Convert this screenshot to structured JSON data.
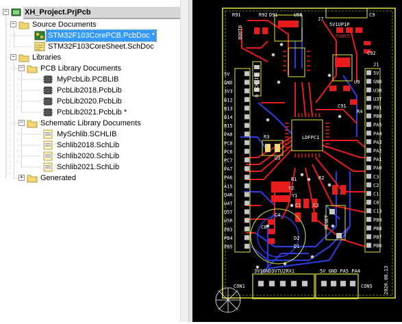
{
  "tree": {
    "root": "XH_Project.PrjPcb",
    "source": {
      "label": "Source Documents",
      "pcb_doc": "STM32F103CorePCB.PcbDoc *",
      "sch_doc": "STM32F103CoreSheet.SchDoc"
    },
    "libraries": {
      "label": "Libraries",
      "pcb_lib_folder": "PCB Library Documents",
      "pcb_libs": [
        "MyPcbLib.PCBLIB",
        "PcbLib2018.PcbLib",
        "PcbLib2020.PcbLib",
        "PcbLib2021.PcbLib *"
      ],
      "sch_lib_folder": "Schematic Library Documents",
      "sch_libs": [
        "MySchlib.SCHLIB",
        "Schlib2018.SchLib",
        "Schlib2020.SchLib",
        "Schlib2021.SchLib"
      ]
    },
    "generated": "Generated",
    "expand_symbols": {
      "minus": "−",
      "plus": "+"
    }
  },
  "pcb": {
    "colors": {
      "board": "#000000",
      "outline": "#e6e640",
      "top_copper": "#e81c1c",
      "bottom_copper": "#2b3bd6",
      "silk": "#ffffff",
      "pad": "#c8c8c8"
    },
    "left_header_labels": [
      "5V",
      "GND",
      "3V3",
      "B12",
      "B13",
      "B14",
      "B15",
      "PA8",
      "PC8",
      "PC6",
      "PC7",
      "PA7",
      "PA6",
      "A15",
      "U4R",
      "U4T",
      "U5T",
      "U5R",
      "PB3",
      "PB4",
      "PB5"
    ],
    "right_header_labels": [
      "J1",
      "5V",
      "GND",
      "U3R",
      "U3T",
      "PB1",
      "PB0",
      "PA5",
      "PA4",
      "PA3",
      "PA2",
      "PA1",
      "PA0",
      "C3",
      "C2",
      "C1",
      "C0",
      "C13",
      "PB9",
      "PB8",
      "PB7",
      "PB6"
    ],
    "component_labels": {
      "r91": "R91",
      "r92": "R92",
      "d91": "D91",
      "u5b": "U5B",
      "j7": "J7",
      "power": "POWER",
      "c9": "C9",
      "c92": "C92",
      "r4": "R4",
      "c91": "C91",
      "u9": "U9",
      "r3": "R3",
      "l1": "L1",
      "r1": "R1",
      "r2": "R2",
      "y1": "Y1",
      "y2": "Y2",
      "c1": "C1",
      "c3": "C3",
      "c4": "C4",
      "c6": "C6",
      "d1": "D1",
      "d2": "D2",
      "ldfpc": "LDFPC1",
      "reset": "RESET",
      "u3": "U3",
      "j1": "J1",
      "con1": "CON1",
      "con5": "CON5",
      "boot": "BOOT0"
    },
    "top_strip_label": "5V1UP1P",
    "swd_label": "G SCK IO",
    "bottom_left_header": "3V3GND3VTU2RX1",
    "bottom_right_header": "5V GND PA5 PA4",
    "date_label": "2020.08.13"
  }
}
